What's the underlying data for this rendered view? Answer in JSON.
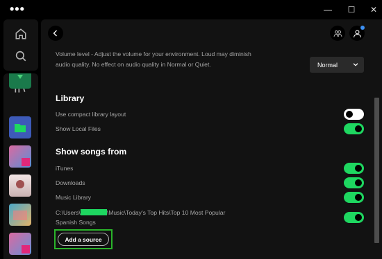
{
  "titlebar": {
    "menu": "•••",
    "minimize": "—",
    "maximize": "☐",
    "close": "✕"
  },
  "icons": {
    "home": "home-icon",
    "search": "search-icon",
    "library": "library-icon",
    "back": "chevron-left-icon",
    "friends": "friends-icon",
    "profile": "user-icon"
  },
  "settings": {
    "volume_description": "Volume level - Adjust the volume for your environment. Loud may diminish audio quality. No effect on audio quality in Normal or Quiet.",
    "volume_selected": "Normal",
    "library_title": "Library",
    "library_rows": [
      {
        "label": "Use compact library layout",
        "on": false
      },
      {
        "label": "Show Local Files",
        "on": true
      }
    ],
    "show_songs_title": "Show songs from",
    "source_rows": [
      {
        "label": "iTunes",
        "on": true
      },
      {
        "label": "Downloads",
        "on": true
      },
      {
        "label": "Music Library",
        "on": true
      }
    ],
    "custom_path_prefix": "C:\\Users\\",
    "custom_path_suffix": "\\Music\\Today's Top Hits\\Top 10 Most Popular",
    "custom_path_line2": "Spanish Songs",
    "add_source_label": "Add a source"
  },
  "colors": {
    "accent": "#1ed760",
    "highlight_box": "#2ab52a",
    "background": "#121212",
    "muted_text": "#a7a7a7"
  }
}
